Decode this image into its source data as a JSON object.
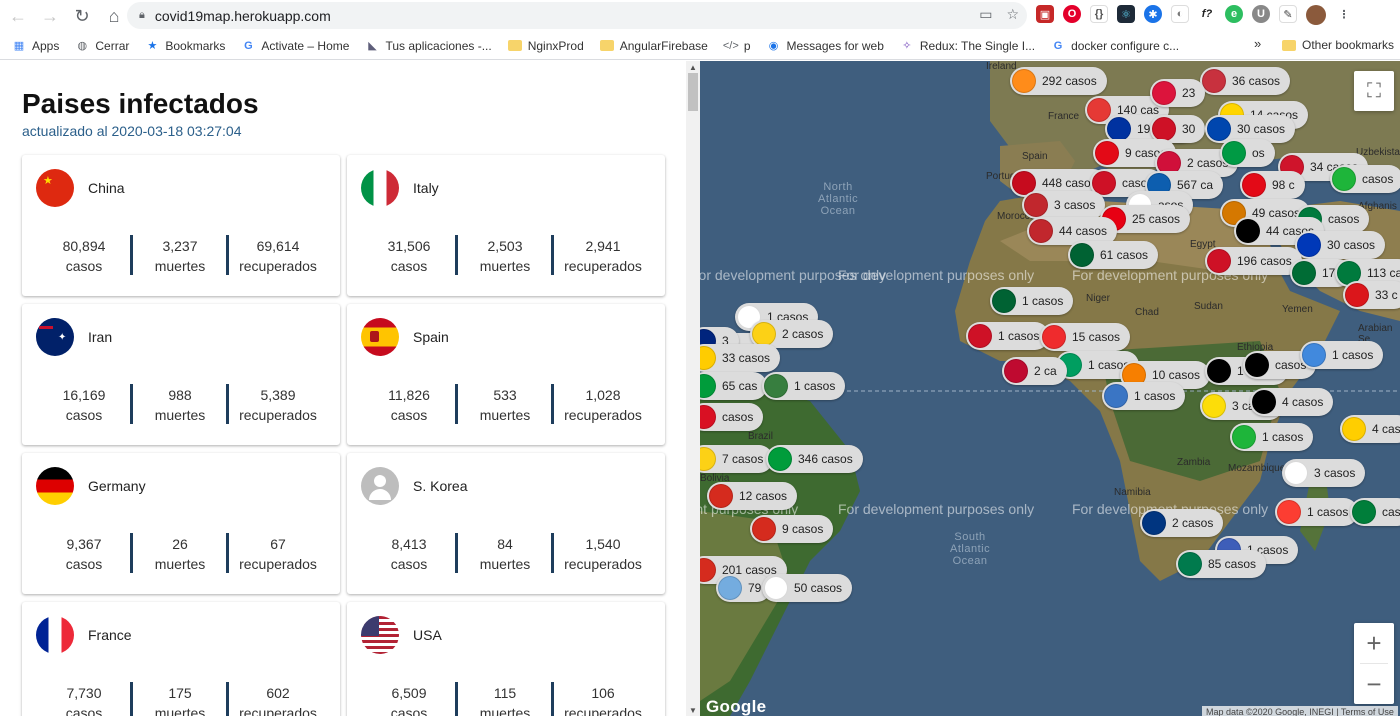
{
  "browser": {
    "url": "covid19map.herokuapp.com",
    "bookmarks": [
      {
        "label": "Apps",
        "icon": "apps-grid-icon",
        "color": "#4285f4"
      },
      {
        "label": "Cerrar",
        "icon": "globe-icon",
        "color": "#5f6368"
      },
      {
        "label": "Bookmarks",
        "icon": "star-icon",
        "color": "#1a73e8"
      },
      {
        "label": "Activate – Home",
        "icon": "google-icon",
        "color": "#4285f4"
      },
      {
        "label": "Tus aplicaciones -...",
        "icon": "heroku-icon",
        "color": "#5e5e7a"
      },
      {
        "label": "NginxProd",
        "icon": "folder-icon",
        "color": "#f7d46a"
      },
      {
        "label": "AngularFirebase",
        "icon": "folder-icon",
        "color": "#f7d46a"
      },
      {
        "label": "p",
        "icon": "code-icon",
        "color": "#5f6368"
      },
      {
        "label": "Messages for web",
        "icon": "messages-icon",
        "color": "#1a73e8"
      },
      {
        "label": "Redux: The Single I...",
        "icon": "redux-icon",
        "color": "#764abc"
      },
      {
        "label": "docker configure c...",
        "icon": "google-icon",
        "color": "#4285f4"
      }
    ],
    "bookmarks_more": "»",
    "other_bookmarks": "Other bookmarks"
  },
  "header": {
    "title": "Paises infectados",
    "updated": "actualizado al 2020-03-18 03:27:04"
  },
  "stat_labels": {
    "cases": "casos",
    "deaths": "muertes",
    "recovered": "recuperados"
  },
  "countries": [
    {
      "name": "China",
      "cases": "80,894",
      "deaths": "3,237",
      "recovered": "69,614",
      "flag": "china"
    },
    {
      "name": "Italy",
      "cases": "31,506",
      "deaths": "2,503",
      "recovered": "2,941",
      "flag": "italy"
    },
    {
      "name": "Iran",
      "cases": "16,169",
      "deaths": "988",
      "recovered": "5,389",
      "flag": "iran"
    },
    {
      "name": "Spain",
      "cases": "11,826",
      "deaths": "533",
      "recovered": "1,028",
      "flag": "spain"
    },
    {
      "name": "Germany",
      "cases": "9,367",
      "deaths": "26",
      "recovered": "67",
      "flag": "germany"
    },
    {
      "name": "S. Korea",
      "cases": "8,413",
      "deaths": "84",
      "recovered": "1,540",
      "flag": "placeholder"
    },
    {
      "name": "France",
      "cases": "7,730",
      "deaths": "175",
      "recovered": "602",
      "flag": "france"
    },
    {
      "name": "USA",
      "cases": "6,509",
      "deaths": "115",
      "recovered": "106",
      "flag": "usa"
    }
  ],
  "map": {
    "watermark": "For development purposes only",
    "ocean_north": "North\nAtlantic\nOcean",
    "ocean_south": "South\nAtlantic\nOcean",
    "places": [
      "Ireland",
      "France",
      "Spain",
      "Portugal",
      "Morocco",
      "Egypt",
      "Niger",
      "Chad",
      "Sudan",
      "Ethiopia",
      "Yemen",
      "Zambia",
      "Namibia",
      "Mozambique",
      "Brazil",
      "Bolivia",
      "Uzbekista",
      "Afghanis",
      "Arabian Se"
    ],
    "markers": [
      {
        "text": "292 casos",
        "color": "#ff8c1a"
      },
      {
        "text": "36 casos",
        "color": "#c8313e"
      },
      {
        "text": "140 cas",
        "color": "#e53935"
      },
      {
        "text": "23",
        "color": "#dc143c"
      },
      {
        "text": "14 casos",
        "color": "#ffd500"
      },
      {
        "text": "19 casos",
        "color": "#0032a0"
      },
      {
        "text": "30",
        "color": "#ce1126"
      },
      {
        "text": "30 casos",
        "color": "#0046ae"
      },
      {
        "text": "9 casos",
        "color": "#e30a17"
      },
      {
        "text": "2 casos",
        "color": "#d0103a"
      },
      {
        "text": "os",
        "color": "#009a44"
      },
      {
        "text": "34 casos",
        "color": "#cf142b"
      },
      {
        "text": "casos",
        "color": "#1eb53a"
      },
      {
        "text": "448 casos",
        "color": "#c60b1e"
      },
      {
        "text": "casos",
        "color": "#ce1126"
      },
      {
        "text": "567 ca",
        "color": "#0d5eaf"
      },
      {
        "text": "98 c",
        "color": "#e30a17"
      },
      {
        "text": "3 casos",
        "color": "#c1272d"
      },
      {
        "text": "asos",
        "color": "#ffffff"
      },
      {
        "text": "25 casos",
        "color": "#e70013"
      },
      {
        "text": "49 casos",
        "color": "#d57800"
      },
      {
        "text": "casos",
        "color": "#007a3d"
      },
      {
        "text": "44 casos",
        "color": "#c1272d"
      },
      {
        "text": "44 casos",
        "color": "#000000"
      },
      {
        "text": "30 casos",
        "color": "#0038b8"
      },
      {
        "text": "61 casos",
        "color": "#006233"
      },
      {
        "text": "196 casos",
        "color": "#ce1126"
      },
      {
        "text": "171",
        "color": "#006c35"
      },
      {
        "text": "113 ca",
        "color": "#007a3d"
      },
      {
        "text": "33 c",
        "color": "#db161b"
      },
      {
        "text": "1 casos",
        "color": "#006233"
      },
      {
        "text": "1 casos",
        "color": "#ce1126"
      },
      {
        "text": "15 casos",
        "color": "#ef2b2d"
      },
      {
        "text": "1 casos",
        "color": "#009e60"
      },
      {
        "text": "2 ca",
        "color": "#bf0a30"
      },
      {
        "text": "10 casos",
        "color": "#f77f00"
      },
      {
        "text": "1 casos",
        "color": "#3a75c4"
      },
      {
        "text": "1 casos",
        "color": "#000000"
      },
      {
        "text": "casos",
        "color": "#000000"
      },
      {
        "text": "1 casos",
        "color": "#4189dd"
      },
      {
        "text": "3 casos",
        "color": "#fcdd09"
      },
      {
        "text": "4 casos",
        "color": "#000000"
      },
      {
        "text": "1 casos",
        "color": "#1eb53a"
      },
      {
        "text": "4 cas",
        "color": "#ffce00"
      },
      {
        "text": "3 casos",
        "color": "#ffffff"
      },
      {
        "text": "1 casos",
        "color": "#fc3d32"
      },
      {
        "text": "cas",
        "color": "#007e3a"
      },
      {
        "text": "2 casos",
        "color": "#003580"
      },
      {
        "text": "1 casos",
        "color": "#3e5eb9"
      },
      {
        "text": "85 casos",
        "color": "#007a4d"
      },
      {
        "text": "casos",
        "color": "#ce1126"
      },
      {
        "text": "1 casos",
        "color": "#ffffff"
      },
      {
        "text": "2 casos",
        "color": "#fcd116"
      },
      {
        "text": "3",
        "color": "#00247d"
      },
      {
        "text": "33 casos",
        "color": "#ffcc00"
      },
      {
        "text": "65 cas",
        "color": "#009c3b"
      },
      {
        "text": "1 casos",
        "color": "#377e3f"
      },
      {
        "text": "casos",
        "color": "#d91023"
      },
      {
        "text": "7 casos",
        "color": "#fcd116"
      },
      {
        "text": "346 casos",
        "color": "#009c3b"
      },
      {
        "text": "12 casos",
        "color": "#d52b1e"
      },
      {
        "text": "9 casos",
        "color": "#d52b1e"
      },
      {
        "text": "201 casos",
        "color": "#d52b1e"
      },
      {
        "text": "79",
        "color": "#74acdf"
      },
      {
        "text": "50 casos",
        "color": "#ffffff"
      }
    ],
    "logo": "Google",
    "terms": "Map data ©2020 Google, INEGI | Terms of Use",
    "zoom_in": "+",
    "zoom_out": "−"
  }
}
